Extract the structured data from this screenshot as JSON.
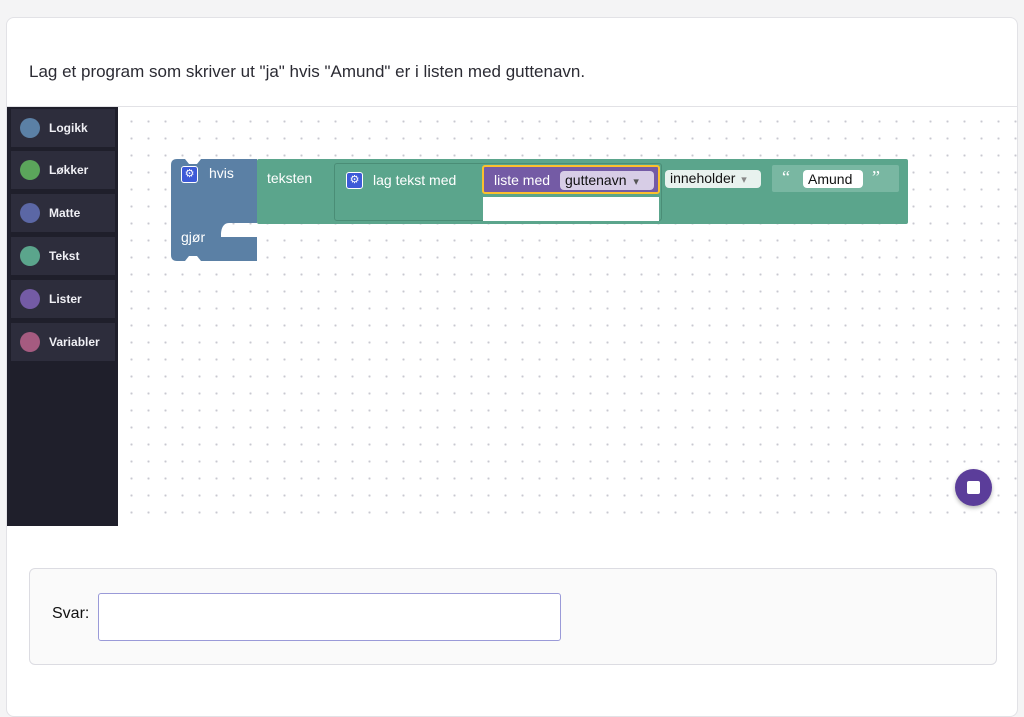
{
  "task": {
    "question": "Lag et program som skriver ut \"ja\" hvis \"Amund\" er i listen med guttenavn."
  },
  "toolbox": {
    "categories": [
      {
        "label": "Logikk",
        "color": "#5b80a5"
      },
      {
        "label": "Løkker",
        "color": "#5ba55b"
      },
      {
        "label": "Matte",
        "color": "#5b67a5"
      },
      {
        "label": "Tekst",
        "color": "#5ba58c"
      },
      {
        "label": "Lister",
        "color": "#745ba5"
      },
      {
        "label": "Variabler",
        "color": "#a55b80"
      }
    ]
  },
  "blocks": {
    "if_label": "hvis",
    "do_label": "gjør",
    "contains_label": "teksten",
    "join_label": "lag tekst med",
    "list_label": "liste med",
    "list_variable": "guttenavn",
    "operator": "inneholder",
    "string_value": "Amund",
    "quote_open": "“",
    "quote_close": "”",
    "gear_icon": "⚙",
    "dropdown_icon": "▾"
  },
  "answer": {
    "label": "Svar:",
    "value": ""
  },
  "colors": {
    "logic": "#5b80a5",
    "text": "#5ba58c",
    "list": "#745ba5",
    "selection": "#fbc02d",
    "stop_button": "#5b3d9a"
  }
}
